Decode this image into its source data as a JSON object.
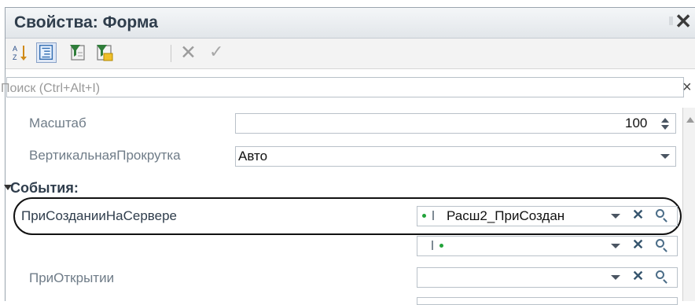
{
  "panel": {
    "title": "Свойства: Форма"
  },
  "toolbar": {
    "icons": [
      "sort-az-icon",
      "categorized-list-icon",
      "filter-icon",
      "filter-settings-icon",
      "cancel-icon",
      "apply-icon"
    ],
    "cancel_glyph": "✕",
    "apply_glyph": "✓"
  },
  "search": {
    "placeholder": "Поиск (Ctrl+Alt+I)",
    "clear_glyph": "×"
  },
  "properties": {
    "scale": {
      "label": "Масштаб",
      "value": "100"
    },
    "vscroll": {
      "label": "ВертикальнаяПрокрутка",
      "value": "Авто"
    }
  },
  "events": {
    "header": "События:",
    "on_create_at_server": {
      "label": "ПриСозданииНаСервере",
      "value": "Расш2_ПриСоздан"
    },
    "second_handler": {
      "value": ""
    },
    "on_open": {
      "label": "ПриОткрытии",
      "value": ""
    }
  },
  "buttons": {
    "clear_glyph": "✕"
  },
  "colors": {
    "accent_green": "#22a33a",
    "highlight_outline": "#111111"
  }
}
